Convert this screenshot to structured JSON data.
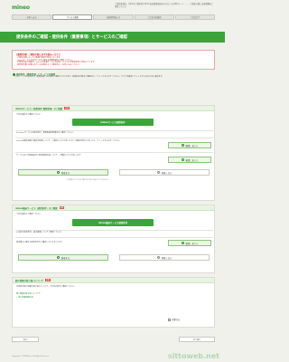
{
  "header": {
    "logo": "mineo",
    "top_note": "ご契約者様は、(IIJmioご契約者) IIJmio会員情報登録済み/ひとつのSIMカード・・・ ご契約の際に必要書類をご用意ください"
  },
  "steps": [
    "お申し込み",
    "サービス選択",
    "お客様情報入力",
    "ご注文内容確認",
    "ご注文完了"
  ],
  "page_title": "提供条件のご確認・提供条件（重要事項）とサービスのご確認",
  "alert": {
    "title": "【重要事項】ご契約の前に必ずお読みください",
    "lines": [
      "・ご契約内容によっては事務手数料が発生いたします。",
      "・mineoサービスのお申し込みに関する重要事項をご確認ください。",
      "・お客様の個人情報は、mineoの各種サービスの提供、ならびに料金請求等に利用いたします。",
      "・提供条件書に記載されている内容をよくご確認の上、お申し込みください。"
    ]
  },
  "check_link": "提供条件（重要事項）とサービスの確認",
  "description": "このページでは提供条件（重要事項）の内容をご確認いただきます。各項目の内容をご確認の上、チェックを入れてください。すべての項目にチェックを入れると次に進めます。",
  "panel1": {
    "header": "mineoサービス（提供条件 重要事項）のご確認",
    "badge": "必須",
    "intro": "下記の資料をご確認ください",
    "button": "mineoサービス提供条件",
    "note": "※ mineoサービスの提供条件、重要事項説明書等をご確認ください。",
    "q1": "mineoの通信速度や通信の制限について、ご確認いただきましたか？ご確認が終わりましたら、チェックを入れてください。",
    "q1_choice": "確認しました",
    "q2": "サービスのご利用開始日や契約解除料等について、ご確認いただきましたか？",
    "q2_choice": "確認しました",
    "agree": "同意する",
    "disagree": "同意しない",
    "small": "※ 同意いただけない場合はお申し込みいただけません。"
  },
  "panel2": {
    "header": "mineo端末サービス（提供条件）のご確認",
    "badge": "必須",
    "intro": "下記の資料をご確認ください",
    "button": "mineo端末サービス提供条件",
    "note": "※ 端末の提供条件、端末補償についてご確認ください。",
    "q1": "端末購入に関する提供条件をご確認いただきましたか？",
    "q1_choice": "確認しました",
    "agree": "同意する",
    "disagree": "同意しない"
  },
  "panel3": {
    "header": "個人情報の取り扱いについて",
    "badge": "必須",
    "line1": "お客様の個人情報の取り扱いについて、下記の内容をご確認ください。",
    "link": "個人情報の取り扱いについて",
    "checkbox": "同意する",
    "link2": "> 個人情報保護方針"
  },
  "footer": {
    "back": "戻る",
    "next": "次へ進む"
  },
  "copyright": "Copyright © OPTAGE Inc. All Rights Reserved.",
  "watermark": "sittoweb.net"
}
